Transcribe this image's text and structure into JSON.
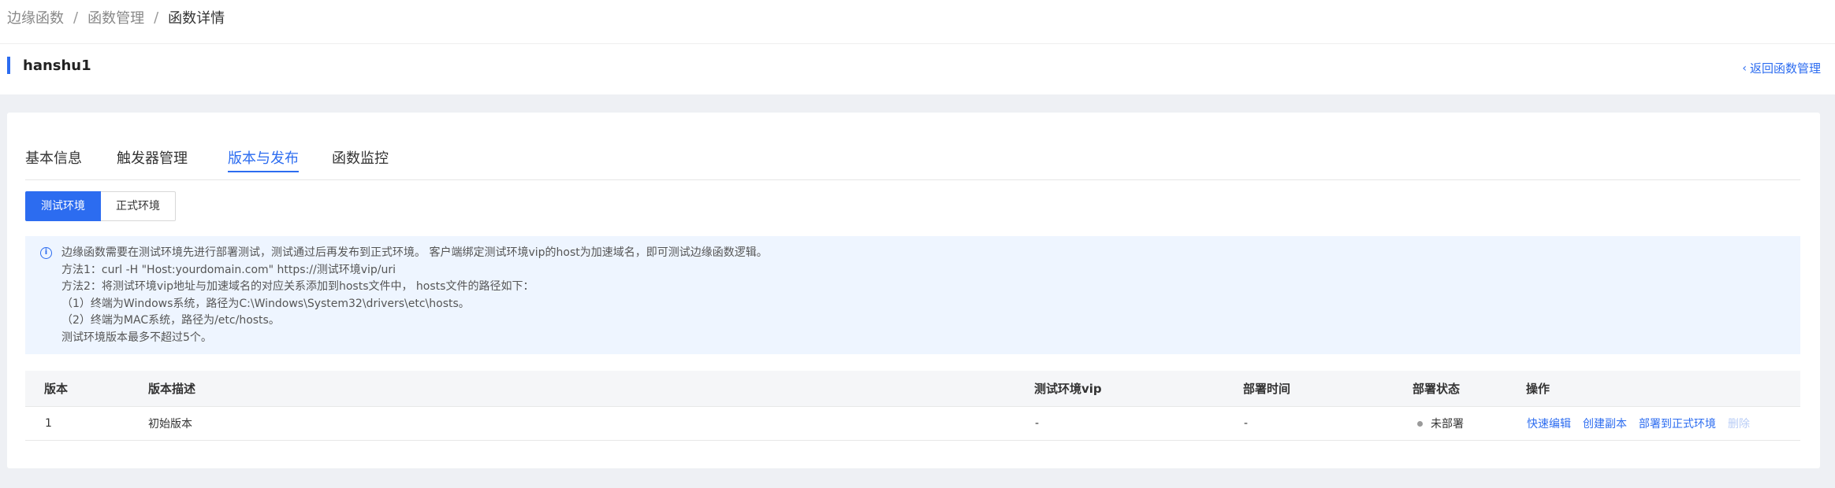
{
  "breadcrumb": [
    "边缘函数",
    "函数管理",
    "函数详情"
  ],
  "breadcrumb_sep": "/",
  "page_title": "hanshu1",
  "back_link": "返回函数管理",
  "tabs": [
    {
      "label": "基本信息",
      "active": false
    },
    {
      "label": "触发器管理",
      "active": false
    },
    {
      "label": "版本与发布",
      "active": true
    },
    {
      "label": "函数监控",
      "active": false
    }
  ],
  "env_toggle": {
    "test": "测试环境",
    "prod": "正式环境",
    "selected": "测试环境"
  },
  "notice": {
    "icon": "info-circle-icon",
    "lines": [
      "边缘函数需要在测试环境先进行部署测试，测试通过后再发布到正式环境。 客户端绑定测试环境vip的host为加速域名，即可测试边缘函数逻辑。",
      "方法1：curl -H \"Host:yourdomain.com\" https://测试环境vip/uri",
      "方法2：将测试环境vip地址与加速域名的对应关系添加到hosts文件中， hosts文件的路径如下：",
      "（1）终端为Windows系统，路径为C:\\Windows\\System32\\drivers\\etc\\hosts。",
      "（2）终端为MAC系统，路径为/etc/hosts。",
      "测试环境版本最多不超过5个。"
    ]
  },
  "table": {
    "headers": [
      "版本",
      "版本描述",
      "测试环境vip",
      "部署时间",
      "部署状态",
      "操作"
    ],
    "rows": [
      {
        "version": "1",
        "description": "初始版本",
        "vip": "-",
        "deploy_time": "-",
        "status": "未部署",
        "actions": [
          "快速编辑",
          "创建副本",
          "部署到正式环境",
          "删除"
        ]
      }
    ]
  },
  "colors": {
    "accent": "#2c6cf0",
    "notice_bg": "#eef5ff",
    "status_dot": "#9a9a9a"
  }
}
